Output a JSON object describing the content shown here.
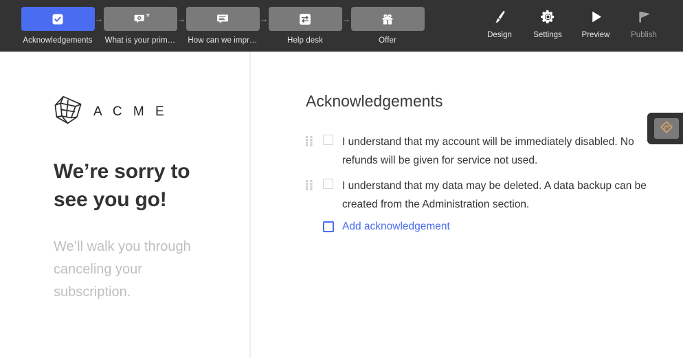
{
  "toolbar": {
    "steps": [
      {
        "label": "Acknowledgements",
        "icon": "checkbox-icon",
        "active": true,
        "required": false
      },
      {
        "label": "What is your prim…",
        "icon": "multiple-choice-icon",
        "active": false,
        "required": true,
        "required_marker": "*"
      },
      {
        "label": "How can we impr…",
        "icon": "open-text-icon",
        "active": false,
        "required": false
      },
      {
        "label": "Help desk",
        "icon": "redirect-icon",
        "active": false,
        "required": false
      },
      {
        "label": "Offer",
        "icon": "gift-icon",
        "active": false,
        "required": false
      }
    ],
    "arrow_glyph": "→",
    "actions": [
      {
        "label": "Design",
        "icon": "brush-icon",
        "dimmed": false
      },
      {
        "label": "Settings",
        "icon": "gear-icon",
        "dimmed": false
      },
      {
        "label": "Preview",
        "icon": "play-icon",
        "dimmed": false
      },
      {
        "label": "Publish",
        "icon": "megaphone-icon",
        "dimmed": true
      }
    ],
    "colors": {
      "bar_background": "#333333",
      "tile_inactive": "#7a7a7a",
      "tile_active": "#4a6cf0",
      "label": "#e8e8e8",
      "label_dim": "#9d9d9d"
    }
  },
  "logic_button": {
    "icon": "logic-branch-icon",
    "accent": "#e0a263"
  },
  "left_pane": {
    "brand": {
      "logo_icon": "acme-polyhedron-logo",
      "name": "A C M E"
    },
    "headline": "We’re sorry to see you go!",
    "subline": "We’ll walk you through canceling your subscription."
  },
  "right_pane": {
    "title": "Acknowledgements",
    "items": [
      {
        "drag_icon": "drag-handle-icon",
        "checked": false,
        "text": "I understand that my account will be immediately disabled. No refunds will be given for service not used."
      },
      {
        "drag_icon": "drag-handle-icon",
        "checked": false,
        "text": "I understand that my data may be deleted. A data backup can be created from the Administration section."
      }
    ],
    "add_item": {
      "label": "Add acknowledgement",
      "icon": "empty-checkbox-icon",
      "color": "#4a6cf0"
    }
  }
}
